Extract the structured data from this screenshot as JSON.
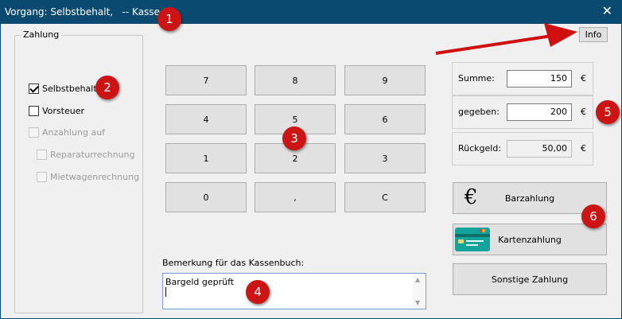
{
  "window": {
    "title": "Vorgang: Selbstbehalt,   -- Kasse 1 --"
  },
  "payment_group": {
    "legend": "Zahlung",
    "options": [
      {
        "label": "Selbstbehalt",
        "checked": true,
        "enabled": true
      },
      {
        "label": "Vorsteuer",
        "checked": false,
        "enabled": true
      },
      {
        "label": "Anzahlung auf",
        "checked": false,
        "enabled": false
      },
      {
        "label": "Reparaturrechnung",
        "checked": false,
        "enabled": false
      },
      {
        "label": "Mietwagenrechnung",
        "checked": false,
        "enabled": false
      }
    ]
  },
  "keypad": {
    "keys": [
      "7",
      "8",
      "9",
      "4",
      "5",
      "6",
      "1",
      "2",
      "3",
      "0",
      ",",
      "C"
    ]
  },
  "note": {
    "label": "Bemerkung für das Kassenbuch:",
    "value": "Bargeld geprüft"
  },
  "info_button": "Info",
  "totals": {
    "summe": {
      "label": "Summe:",
      "value": "150",
      "currency": "€"
    },
    "gegeben": {
      "label": "gegeben:",
      "value": "200",
      "currency": "€"
    },
    "rueckgeld": {
      "label": "Rückgeld:",
      "value": "50,00",
      "currency": "€"
    }
  },
  "payment_buttons": {
    "cash": "Barzahlung",
    "card": "Kartenzahlung",
    "other": "Sonstige Zahlung"
  },
  "annotations": [
    "1",
    "2",
    "3",
    "4",
    "5",
    "6"
  ],
  "colors": {
    "titlebar": "#0b4a70",
    "badge": "#cc1414",
    "arrow": "#d01010",
    "card": "#14a39a"
  }
}
